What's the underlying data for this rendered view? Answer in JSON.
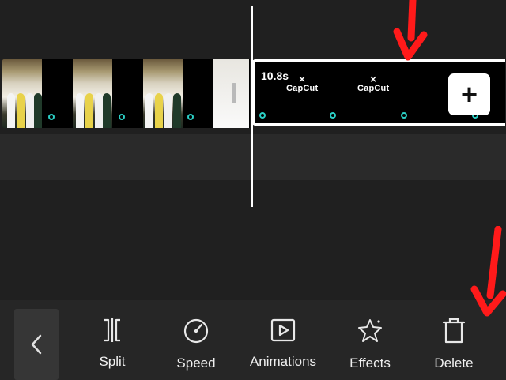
{
  "timeline": {
    "selected_clip": {
      "duration_label": "10.8s",
      "watermarks": [
        "CapCut",
        "CapCut"
      ]
    },
    "add_button_label": "+"
  },
  "toolbar": {
    "back_label": "<",
    "tools": [
      {
        "label": "Split",
        "icon": "split-icon"
      },
      {
        "label": "Speed",
        "icon": "speed-icon"
      },
      {
        "label": "Animations",
        "icon": "animations-icon"
      },
      {
        "label": "Effects",
        "icon": "effects-icon"
      },
      {
        "label": "Delete",
        "icon": "delete-icon"
      }
    ]
  },
  "colors": {
    "background": "#202020",
    "toolbar": "#262626",
    "annotation_arrow": "#ff1a1a",
    "keyframe_dot": "#2bd0c6"
  }
}
